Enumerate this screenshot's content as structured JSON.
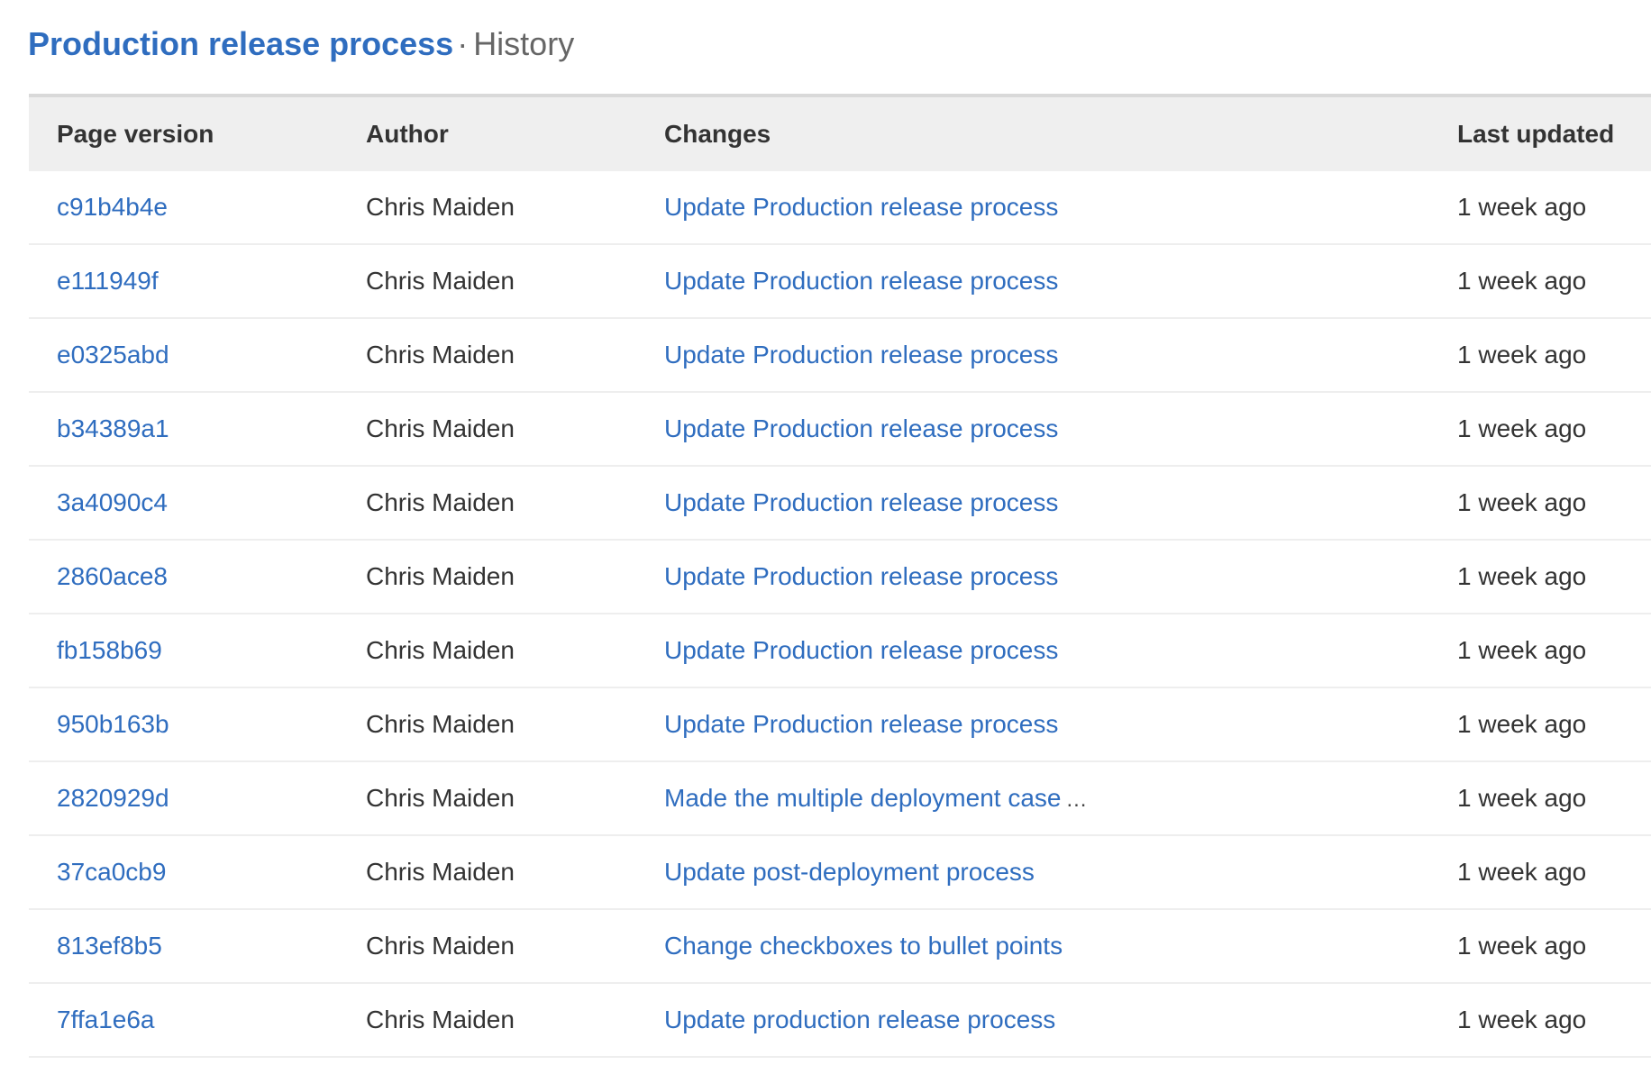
{
  "header": {
    "title": "Production release process",
    "separator": "·",
    "subtitle": "History"
  },
  "table": {
    "columns": {
      "version": "Page version",
      "author": "Author",
      "changes": "Changes",
      "updated": "Last updated"
    },
    "rows": [
      {
        "version": "c91b4b4e",
        "author": "Chris Maiden",
        "change": "Update Production release process",
        "truncated": false,
        "updated": "1 week ago"
      },
      {
        "version": "e111949f",
        "author": "Chris Maiden",
        "change": "Update Production release process",
        "truncated": false,
        "updated": "1 week ago"
      },
      {
        "version": "e0325abd",
        "author": "Chris Maiden",
        "change": "Update Production release process",
        "truncated": false,
        "updated": "1 week ago"
      },
      {
        "version": "b34389a1",
        "author": "Chris Maiden",
        "change": "Update Production release process",
        "truncated": false,
        "updated": "1 week ago"
      },
      {
        "version": "3a4090c4",
        "author": "Chris Maiden",
        "change": "Update Production release process",
        "truncated": false,
        "updated": "1 week ago"
      },
      {
        "version": "2860ace8",
        "author": "Chris Maiden",
        "change": "Update Production release process",
        "truncated": false,
        "updated": "1 week ago"
      },
      {
        "version": "fb158b69",
        "author": "Chris Maiden",
        "change": "Update Production release process",
        "truncated": false,
        "updated": "1 week ago"
      },
      {
        "version": "950b163b",
        "author": "Chris Maiden",
        "change": "Update Production release process",
        "truncated": false,
        "updated": "1 week ago"
      },
      {
        "version": "2820929d",
        "author": "Chris Maiden",
        "change": "Made the multiple deployment case",
        "truncated": true,
        "more_label": "...",
        "updated": "1 week ago"
      },
      {
        "version": "37ca0cb9",
        "author": "Chris Maiden",
        "change": "Update post-deployment process",
        "truncated": false,
        "updated": "1 week ago"
      },
      {
        "version": "813ef8b5",
        "author": "Chris Maiden",
        "change": "Change checkboxes to bullet points",
        "truncated": false,
        "updated": "1 week ago"
      },
      {
        "version": "7ffa1e6a",
        "author": "Chris Maiden",
        "change": "Update production release process",
        "truncated": false,
        "updated": "1 week ago"
      }
    ]
  },
  "colors": {
    "link": "#2f6dbf",
    "text": "#333333",
    "header_bg": "#efefef",
    "border_top": "#d9d9d9",
    "row_border": "#eeeeee"
  }
}
